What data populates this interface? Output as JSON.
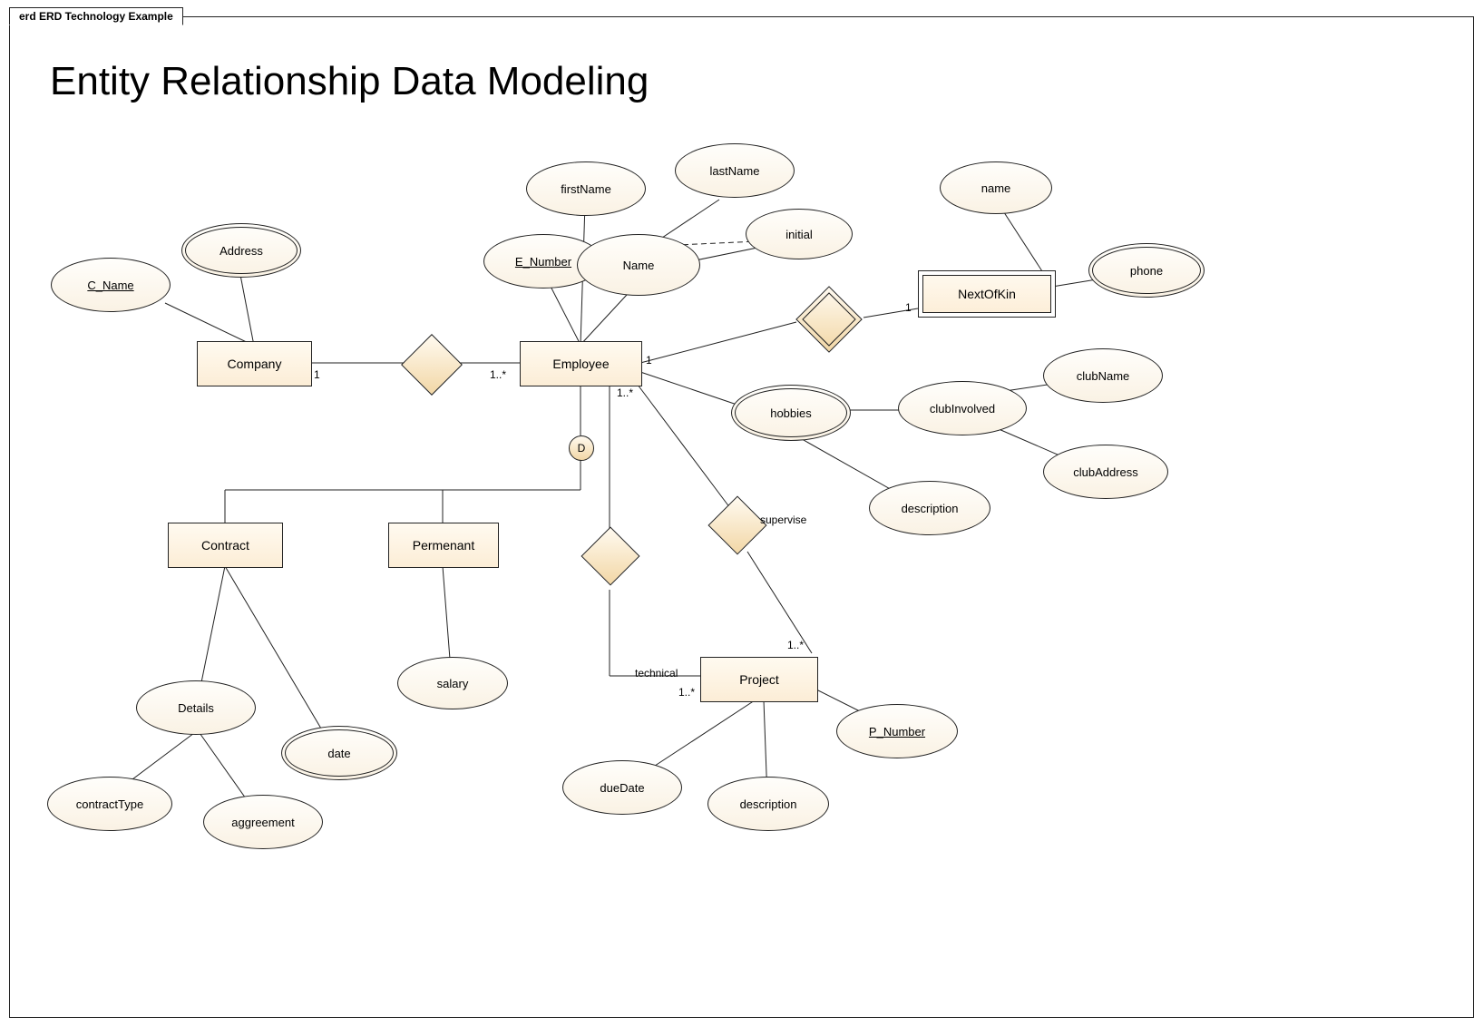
{
  "tab_label": "erd ERD Technology Example",
  "title": "Entity Relationship Data Modeling",
  "entities": {
    "company": "Company",
    "employee": "Employee",
    "contract": "Contract",
    "permanent": "Permenant",
    "project": "Project",
    "nextofkin": "NextOfKin"
  },
  "attributes": {
    "c_name": "C_Name",
    "address": "Address",
    "e_number": "E_Number",
    "first_name": "firstName",
    "last_name": "lastName",
    "initial": "initial",
    "name_comp": "Name",
    "nok_name": "name",
    "phone": "phone",
    "hobbies": "hobbies",
    "club_involved": "clubInvolved",
    "club_name": "clubName",
    "club_address": "clubAddress",
    "hobby_desc": "description",
    "salary": "salary",
    "details": "Details",
    "contract_type": "contractType",
    "aggreement": "aggreement",
    "date": "date",
    "p_number": "P_Number",
    "due_date": "dueDate",
    "proj_desc": "description"
  },
  "labels": {
    "supervise": "supervise",
    "technical": "technical",
    "disjoint": "D"
  },
  "cardinalities": {
    "company_side": "1",
    "employee_company_side": "1..*",
    "employee_nok_side": "1",
    "nok_side": "1",
    "employee_project_side": "1..*",
    "project_tech_side": "1..*",
    "project_sup_side": "1..*"
  }
}
